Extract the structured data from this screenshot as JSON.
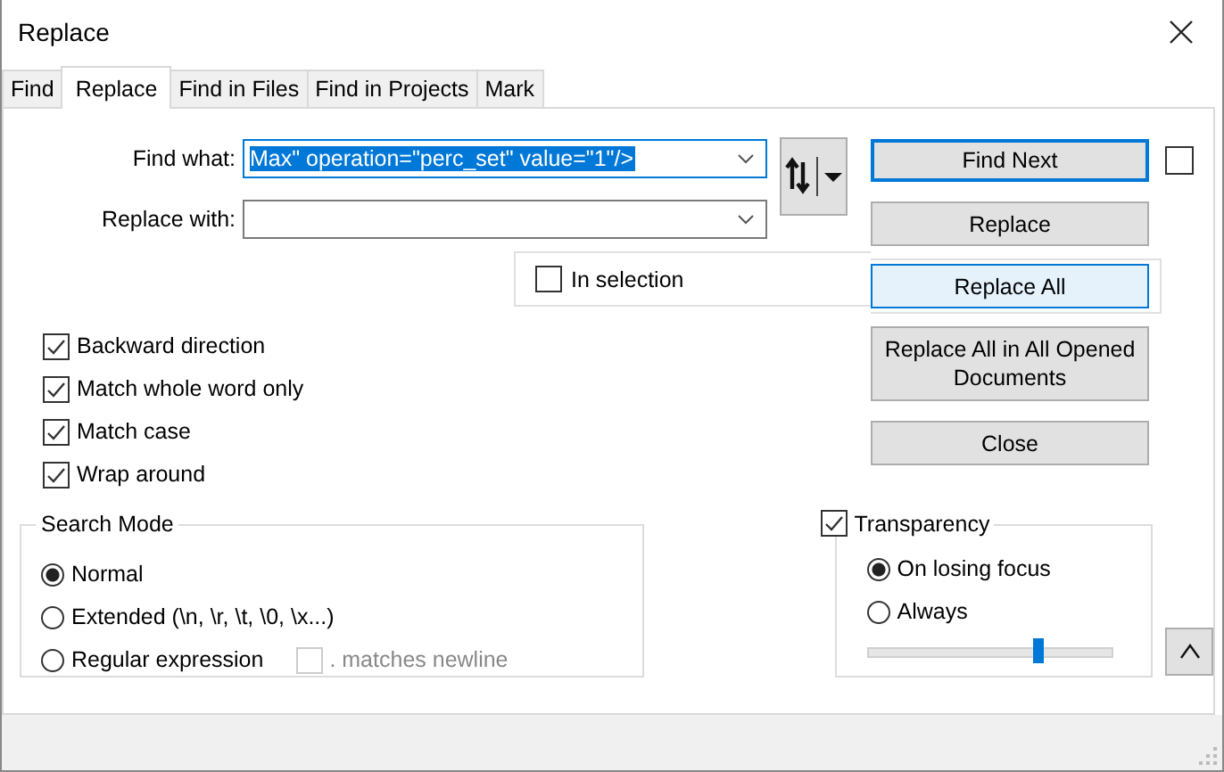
{
  "window": {
    "title": "Replace"
  },
  "tabs": [
    {
      "label": "Find",
      "selected": false
    },
    {
      "label": "Replace",
      "selected": true
    },
    {
      "label": "Find in Files",
      "selected": false
    },
    {
      "label": "Find in Projects",
      "selected": false
    },
    {
      "label": "Mark",
      "selected": false
    }
  ],
  "find_what": {
    "label": "Find what:",
    "value": "Max\" operation=\"perc_set\" value=\"1\"/>",
    "text_selected": true
  },
  "replace_with": {
    "label": "Replace with:"
  },
  "in_selection": {
    "label": "In selection",
    "checked": false
  },
  "buttons": [
    {
      "label": "Find Next",
      "default": true,
      "hovered": false
    },
    {
      "label": "Replace",
      "default": false,
      "hovered": false
    },
    {
      "label": "Replace All",
      "default": false,
      "hovered": true
    },
    {
      "label": "Replace All in All Opened Documents",
      "default": false,
      "hovered": false
    },
    {
      "label": "Close",
      "default": false,
      "hovered": false
    }
  ],
  "find_next_option": {
    "checked": false
  },
  "options": [
    {
      "label": "Backward direction",
      "checked": true
    },
    {
      "label": "Match whole word only",
      "checked": true
    },
    {
      "label": "Match case",
      "checked": true
    },
    {
      "label": "Wrap around",
      "checked": true
    }
  ],
  "search_mode": {
    "title": "Search Mode",
    "options": [
      {
        "label": "Normal",
        "selected": true
      },
      {
        "label": "Extended (\\n, \\r, \\t, \\0, \\x...)",
        "selected": false
      },
      {
        "label": "Regular expression",
        "selected": false
      }
    ],
    "matches_newline": {
      "label": ". matches newline",
      "checked": false,
      "disabled": true
    }
  },
  "transparency": {
    "label": "Transparency",
    "checked": true,
    "options": [
      {
        "label": "On losing focus",
        "selected": true
      },
      {
        "label": "Always",
        "selected": false
      }
    ],
    "slider": {
      "level": 0.7
    }
  }
}
